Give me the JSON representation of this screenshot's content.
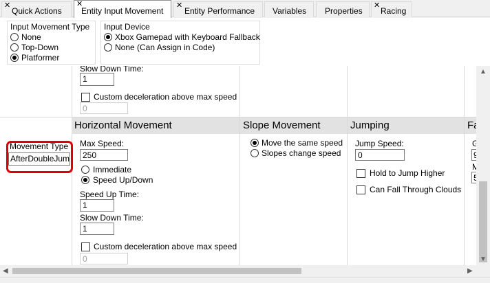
{
  "tabs": [
    {
      "label": "Quick Actions",
      "close": "✕"
    },
    {
      "label": "Entity Input Movement",
      "close": "✕"
    },
    {
      "label": "Entity Performance",
      "close": "✕"
    },
    {
      "label": "Variables"
    },
    {
      "label": "Properties"
    },
    {
      "label": "Racing",
      "close": "✕"
    }
  ],
  "input_movement_type": {
    "title": "Input Movement Type",
    "options": [
      "None",
      "Top-Down",
      "Platformer"
    ],
    "selected": "Platformer"
  },
  "input_device": {
    "title": "Input Device",
    "options": [
      "Xbox Gamepad with Keyboard Fallback",
      "None (Can Assign in Code)"
    ],
    "selected": "Xbox Gamepad with Keyboard Fallback"
  },
  "upper_row": {
    "slow_down_label": "Slow Down Time:",
    "slow_down_value": "1",
    "custom_decel_label": "Custom deceleration above max speed",
    "custom_decel_value": "0"
  },
  "movement_type": {
    "label": "Movement Type",
    "value": "AfterDoubleJum",
    "highlight_color": "#e00000"
  },
  "headers": {
    "horizontal": "Horizontal Movement",
    "slope": "Slope Movement",
    "jumping": "Jumping",
    "falling": "Fa"
  },
  "horizontal": {
    "max_speed_label": "Max Speed:",
    "max_speed_value": "250",
    "opt_immediate": "Immediate",
    "opt_speed_up": "Speed Up/Down",
    "selected": "Speed Up/Down",
    "speed_up_label": "Speed Up Time:",
    "speed_up_value": "1",
    "slow_down_label": "Slow Down Time:",
    "slow_down_value": "1",
    "custom_decel_label": "Custom deceleration above max speed",
    "custom_decel_value": "0"
  },
  "slope": {
    "opt_same": "Move the same speed",
    "opt_change": "Slopes change speed",
    "selected": "Move the same speed"
  },
  "jumping": {
    "jump_speed_label": "Jump Speed:",
    "jump_speed_value": "0",
    "hold_label": "Hold to Jump Higher",
    "clouds_label": "Can Fall Through Clouds"
  },
  "falling_partial": {
    "label1": "G",
    "value1": "9",
    "label2": "M",
    "value2": "5"
  }
}
